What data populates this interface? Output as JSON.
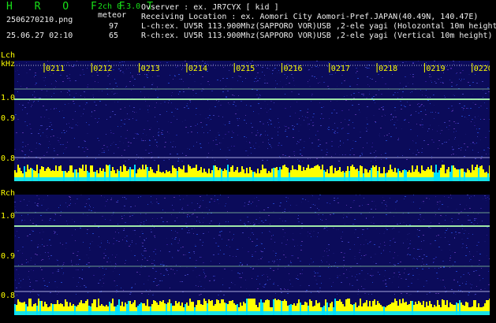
{
  "header": {
    "brand": "H R O F F T",
    "version": "2ch 0.3.0",
    "mode": "meteor",
    "filename": "2506270210.png",
    "datetime": "25.06.27 02:10",
    "lch_count": "97",
    "rch_count": "65",
    "observer": "Ovserver          : ex. JR7CYX [ kid ]",
    "location": "Receiving Location : ex. Aomori City Aomori-Pref.JAPAN(40.49N, 140.47E)",
    "lch_info": "L-ch:ex. UV5R 113.900Mhz(SAPPORO VOR)USB ,2-ele yagi (Holozontal 10m height)",
    "rch_info": "R-ch:ex. UV5R 113.900Mhz(SAPPORO VOR)USB ,2-ele yagi (Vertical 10m height)"
  },
  "lch": {
    "label": "Lch",
    "unit": "kHz",
    "yticks": [
      "1.0",
      "0.9",
      "0.8"
    ],
    "xticks": [
      "0211",
      "0212",
      "0213",
      "0214",
      "0215",
      "0216",
      "0217",
      "0218",
      "0219",
      "0220"
    ]
  },
  "rch": {
    "label": "Rch",
    "unit": "kHz",
    "yticks": [
      "1.0",
      "0.9",
      "0.8"
    ]
  },
  "colors": {
    "noise_bg": "#0b0b5a",
    "carrier": "#b0ffb0",
    "level_bars": "#ffff00",
    "level_cyan": "#00e0ff"
  }
}
